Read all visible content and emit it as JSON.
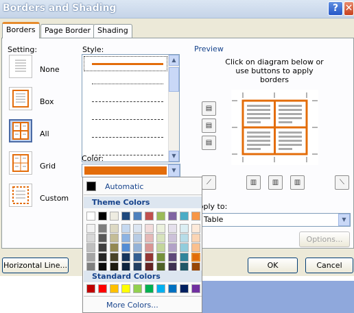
{
  "window": {
    "title": "Borders and Shading",
    "help_label": "?",
    "close_label": "✕"
  },
  "tabs": [
    {
      "label": "Borders",
      "active": true
    },
    {
      "label": "Page Border",
      "active": false
    },
    {
      "label": "Shading",
      "active": false
    }
  ],
  "setting": {
    "heading": "Setting:",
    "options": [
      {
        "label": "None",
        "selected": false
      },
      {
        "label": "Box",
        "selected": false
      },
      {
        "label": "All",
        "selected": true
      },
      {
        "label": "Grid",
        "selected": false
      },
      {
        "label": "Custom",
        "selected": false
      }
    ]
  },
  "style": {
    "heading": "Style:",
    "selected_style": "solid-thick"
  },
  "color": {
    "heading": "Color:",
    "value_hex": "#E36C09"
  },
  "preview": {
    "heading": "Preview",
    "instructions": "Click on diagram below or use buttons to apply borders"
  },
  "apply": {
    "heading": "Apply to:",
    "value": "Table"
  },
  "buttons": {
    "options": "Options...",
    "horizontal_line": "Horizontal Line...",
    "ok": "OK",
    "cancel": "Cancel"
  },
  "palette": {
    "automatic": "Automatic",
    "theme_header": "Theme Colors",
    "standard_header": "Standard Colors",
    "more_colors": "More Colors...",
    "theme_top": [
      "#FFFFFF",
      "#000000",
      "#EEECE1",
      "#1F497D",
      "#4F81BD",
      "#C0504D",
      "#9BBB59",
      "#8064A2",
      "#4BACC6",
      "#F79646"
    ],
    "theme_columns": [
      [
        "#F2F2F2",
        "#D8D8D8",
        "#BFBFBF",
        "#A5A5A5",
        "#7F7F7F"
      ],
      [
        "#7F7F7F",
        "#595959",
        "#3F3F3F",
        "#262626",
        "#0C0C0C"
      ],
      [
        "#DDD9C3",
        "#C4BD97",
        "#938953",
        "#494429",
        "#1D1B10"
      ],
      [
        "#C6D9F0",
        "#8DB3E2",
        "#548DD4",
        "#17365D",
        "#0F243E"
      ],
      [
        "#DBE5F1",
        "#B8CCE4",
        "#95B3D7",
        "#366092",
        "#244061"
      ],
      [
        "#F2DCDB",
        "#E5B9B7",
        "#D99694",
        "#953734",
        "#632423"
      ],
      [
        "#EBF1DD",
        "#D7E3BC",
        "#C3D69B",
        "#76923C",
        "#4F6128"
      ],
      [
        "#E5E0EC",
        "#CCC1D9",
        "#B2A2C7",
        "#5F497A",
        "#3F3151"
      ],
      [
        "#DBEEF3",
        "#B7DDE8",
        "#92CDDC",
        "#31859B",
        "#205867"
      ],
      [
        "#FDEADA",
        "#FBD5B5",
        "#FAC08F",
        "#E36C09",
        "#974806"
      ]
    ],
    "selected": "#E36C09",
    "standard": [
      "#C00000",
      "#FF0000",
      "#FFC000",
      "#FFFF00",
      "#92D050",
      "#00B050",
      "#00B0F0",
      "#0070C0",
      "#002060",
      "#7030A0"
    ]
  }
}
